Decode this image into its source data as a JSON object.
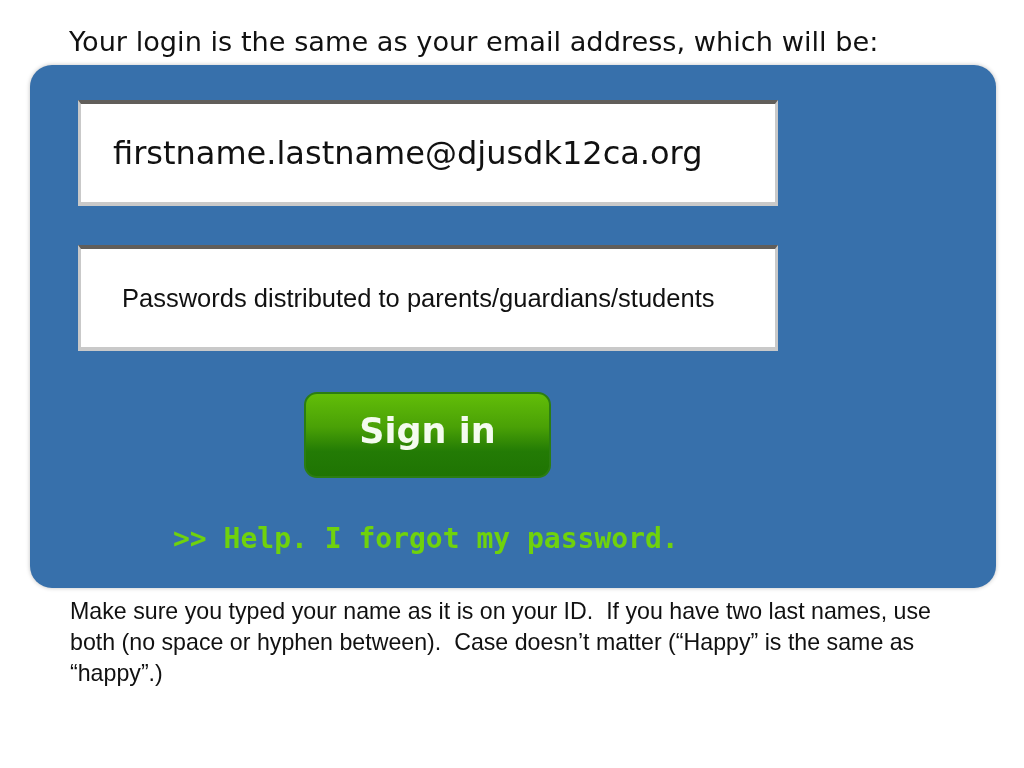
{
  "heading": "Your login is the same as your email address, which will be:",
  "login_panel": {
    "email_field": {
      "value": "firstname.lastname@djusdk12ca.org"
    },
    "password_field": {
      "value": "Passwords distributed to parents/guardians/students"
    },
    "sign_in_button": {
      "label": "Sign in"
    },
    "help_link": {
      "label": ">> Help. I forgot my password."
    }
  },
  "note": "Make sure you typed your name as it is on your ID.  If you have two last names, use both (no space or hyphen between).  Case doesn’t matter (“Happy” is the same as “happy”.)"
}
